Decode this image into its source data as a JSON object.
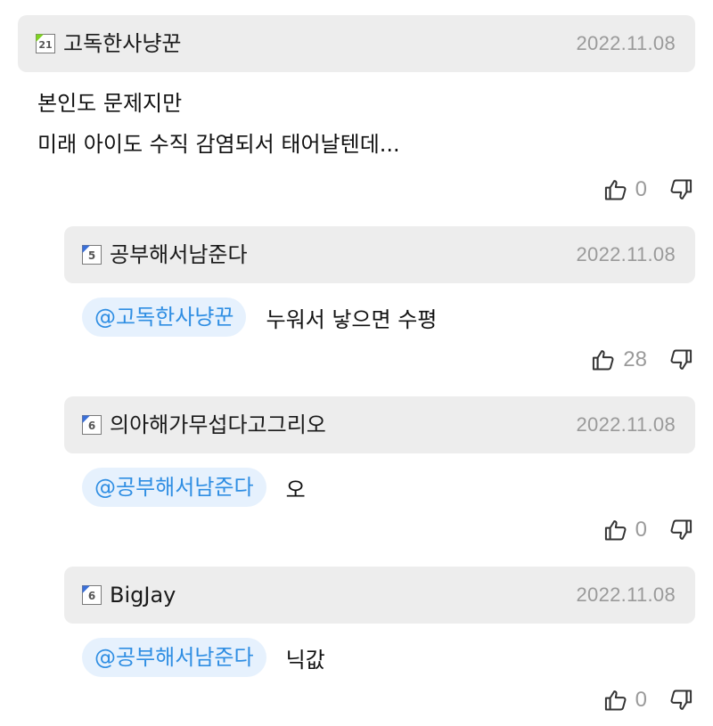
{
  "comments": [
    {
      "username": "고독한사냥꾼",
      "level_icon": "level-21-icon",
      "date": "2022.11.08",
      "lines": [
        "본인도 문제지만",
        "미래 아이도 수직 감염되서 태어날텐데..."
      ],
      "likes": "0"
    },
    {
      "username": "공부해서남준다",
      "level_icon": "level-5-icon",
      "date": "2022.11.08",
      "mention": "@고독한사냥꾼",
      "text": "누워서 낳으면 수평",
      "likes": "28"
    },
    {
      "username": "의아해가무섭다고그리오",
      "level_icon": "level-6-icon",
      "date": "2022.11.08",
      "mention": "@공부해서남준다",
      "text": "오",
      "likes": "0"
    },
    {
      "username": "BigJay",
      "level_icon": "level-6-icon",
      "date": "2022.11.08",
      "mention": "@공부해서남준다",
      "text": "닉값",
      "likes": "0"
    }
  ],
  "colors": {
    "header_bg": "#ededed",
    "mention_bg": "#e6f1fd",
    "mention_text": "#2f8ee3",
    "muted_text": "#9a9a9a"
  }
}
